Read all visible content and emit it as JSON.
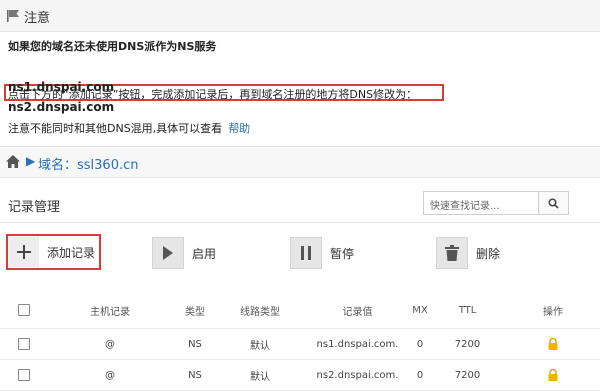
{
  "notice": {
    "title": "注意",
    "line1": "如果您的域名还未使用DNS派作为NS服务",
    "line2": "点击下方的“添加记录”按钮，完成添加记录后，再到域名注册的地方将DNS修改为：",
    "ns1": "ns1.dnspai.com",
    "ns2": "ns2.dnspai.com",
    "line3": "注意不能同时和其他DNS混用,具体可以查看",
    "help": "帮助"
  },
  "breadcrumb": {
    "arrow": "▶",
    "domain": "域名：ssl360.cn"
  },
  "records": {
    "title": "记录管理",
    "search_placeholder": "快速查找记录..."
  },
  "toolbar": {
    "add": "添加记录",
    "enable": "启用",
    "pause": "暂停",
    "delete": "删除"
  },
  "table": {
    "columns": [
      "主机记录",
      "类型",
      "线路类型",
      "记录值",
      "MX",
      "TTL",
      "操作"
    ],
    "rows": [
      {
        "host": "@",
        "type": "NS",
        "line": "默认",
        "value": "ns1.dnspai.com.",
        "mx": "0",
        "ttl": "7200"
      },
      {
        "host": "@",
        "type": "NS",
        "line": "默认",
        "value": "ns2.dnspai.com.",
        "mx": "0",
        "ttl": "7200"
      }
    ]
  },
  "colors": {
    "highlight_border": "#d93a3a",
    "link": "#2a6fb5",
    "lock": "#f0b400"
  }
}
